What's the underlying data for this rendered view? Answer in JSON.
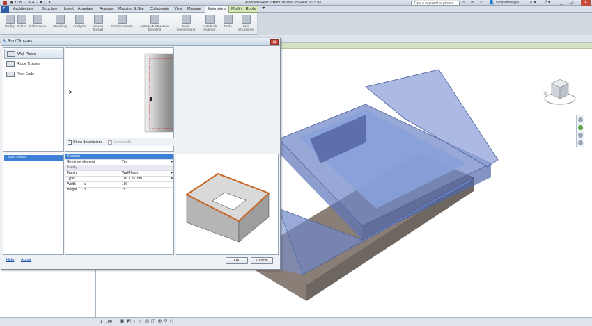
{
  "app": {
    "title": "Autodesk Revit 2015",
    "document": "Roof Trusses for Revit 2015.rvt",
    "search_placeholder": "Type a keyword or phrase",
    "user": "sublpartner@a..."
  },
  "ribbon": {
    "tabs": [
      "Architecture",
      "Structure",
      "Insert",
      "Annotate",
      "Analyze",
      "Massing & Site",
      "Collaborate",
      "View",
      "Manage",
      "Extensions",
      "Modify | Roofs"
    ],
    "active_tab": "Extensions",
    "buttons": [
      "Modify",
      "Delete",
      "References",
      "Modeling",
      "Analysis",
      "Import Export",
      "Reinforcement",
      "AutoCAD Structural Detailing",
      "Steel Connections",
      "Autodesk Inventor",
      "Tools",
      "Civil Structures"
    ]
  },
  "dialog": {
    "title": "Roof Trusses",
    "roof_types": [
      {
        "label": "Wall Plates",
        "selected": true
      },
      {
        "label": "Ridge Trusses",
        "selected": false
      },
      {
        "label": "Roof Ends",
        "selected": false
      }
    ],
    "show_descriptions_label": "Show descriptions",
    "show_descriptions_checked": true,
    "show_walls_label": "Show walls",
    "show_walls_checked": true,
    "element_list": [
      "Wall Plates"
    ],
    "properties": {
      "header": "Creation",
      "generate_element_label": "Generate element",
      "generate_element_value": "Yes",
      "group_label": "Family",
      "family_label": "Family",
      "family_value": "WallPlates",
      "type_label": "Type",
      "type_value": "100 x 25 mm",
      "width_label": "Width",
      "width_symbol": "w",
      "width_value": "100",
      "height_label": "Height",
      "height_symbol": "h",
      "height_value": "25"
    },
    "help_label": "Help",
    "about_label": "About",
    "ok_label": "OK",
    "cancel_label": "Cancel"
  },
  "statusbar": {
    "scale": "1 : 100"
  },
  "colors": {
    "roof_blue": "#6f86c8",
    "truss_orange": "#c8641e",
    "selection_blue": "#3d7ed6",
    "walls_grey": "#8a7f77"
  }
}
